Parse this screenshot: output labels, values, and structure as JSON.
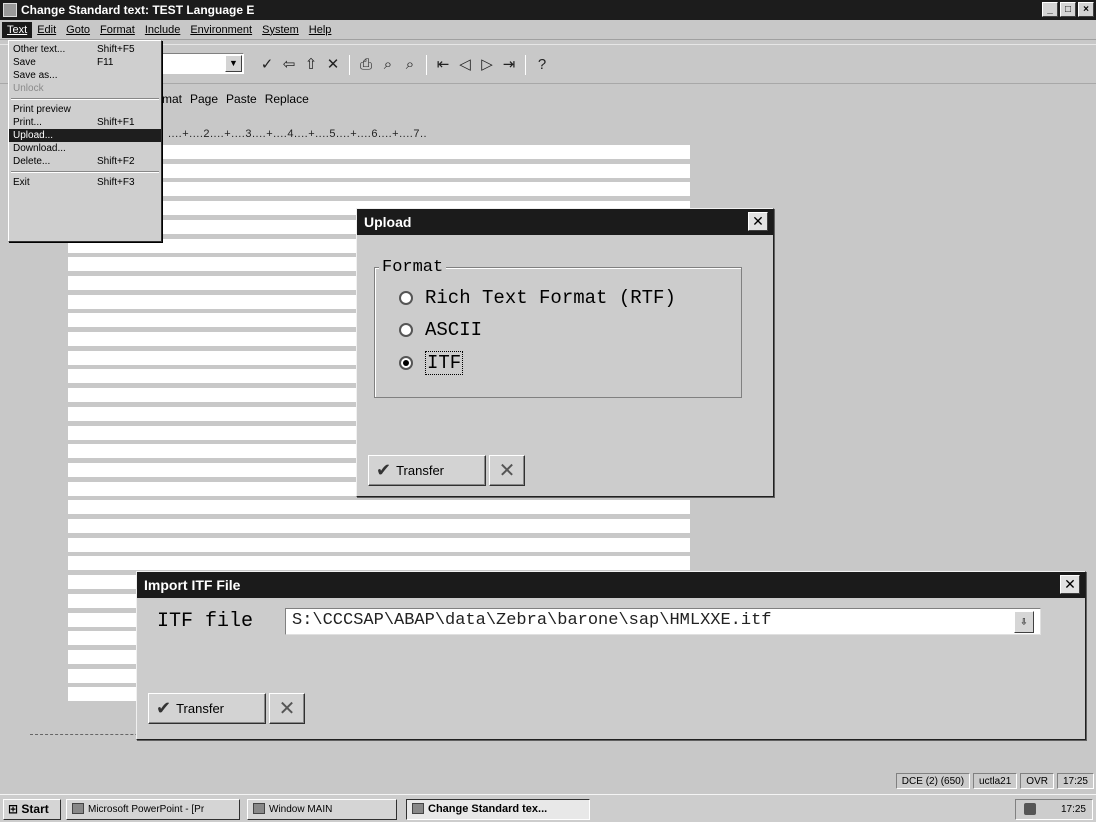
{
  "window": {
    "title": "Change Standard text: TEST Language E",
    "min": "_",
    "max": "□",
    "close": "×"
  },
  "menubar": [
    "Text",
    "Edit",
    "Goto",
    "Format",
    "Include",
    "Environment",
    "System",
    "Help"
  ],
  "text_menu": [
    {
      "label": "Other text...",
      "shortcut": "Shift+F5",
      "state": "normal"
    },
    {
      "label": "Save",
      "shortcut": "F11",
      "state": "normal"
    },
    {
      "label": "Save as...",
      "shortcut": "",
      "state": "normal"
    },
    {
      "label": "Unlock",
      "shortcut": "",
      "state": "disabled"
    },
    {
      "label": "Print preview",
      "shortcut": "",
      "state": "normal"
    },
    {
      "label": "Print...",
      "shortcut": "Shift+F1",
      "state": "normal"
    },
    {
      "label": "Upload...",
      "shortcut": "",
      "state": "highlighted"
    },
    {
      "label": "Download...",
      "shortcut": "",
      "state": "normal"
    },
    {
      "label": "Delete...",
      "shortcut": "Shift+F2",
      "state": "normal"
    },
    {
      "label": "Exit",
      "shortcut": "Shift+F3",
      "state": "normal"
    }
  ],
  "toolbar": {
    "groups": [
      [
        "check-icon",
        "back-icon",
        "up-icon",
        "cancel-icon"
      ],
      [
        "print-icon",
        "find-icon",
        "find-next-icon"
      ],
      [
        "first-page-icon",
        "previous-page-icon",
        "next-page-icon",
        "last-page-icon"
      ],
      [
        "help-icon"
      ]
    ],
    "glyphs": {
      "check-icon": "✓",
      "back-icon": "⇦",
      "up-icon": "⇧",
      "cancel-icon": "✕",
      "print-icon": "⎙",
      "find-icon": "⌕",
      "find-next-icon": "⌕",
      "first-page-icon": "⇤",
      "previous-page-icon": "◁",
      "next-page-icon": "▷",
      "last-page-icon": "⇥",
      "help-icon": "?"
    }
  },
  "subtoolbar": [
    "rmat",
    "Page",
    "Paste",
    "Replace"
  ],
  "ruler": "....+....2....+....3....+....4....+....5....+....6....+....7..",
  "upload_dialog": {
    "title": "Upload",
    "group_label": "Format",
    "options": [
      {
        "label": "Rich Text Format (RTF)",
        "selected": false
      },
      {
        "label": "ASCII",
        "selected": false
      },
      {
        "label": "ITF",
        "selected": true
      }
    ],
    "transfer_label": "Transfer"
  },
  "import_dialog": {
    "title": "Import ITF File",
    "field_label": "ITF file",
    "field_value": "S:\\CCCSAP\\ABAP\\data\\Zebra\\barone\\sap\\HMLXXE.itf",
    "transfer_label": "Transfer"
  },
  "statusbar": [
    "DCE (2) (650)",
    "uctla21",
    "OVR",
    "17:25"
  ],
  "taskbar": {
    "start": "Start",
    "tasks": [
      {
        "label": "Microsoft PowerPoint - [Pr",
        "pressed": false
      },
      {
        "label": "Window MAIN",
        "pressed": false
      },
      {
        "label": "Change Standard tex...",
        "pressed": true
      }
    ],
    "clock": "17:25"
  }
}
